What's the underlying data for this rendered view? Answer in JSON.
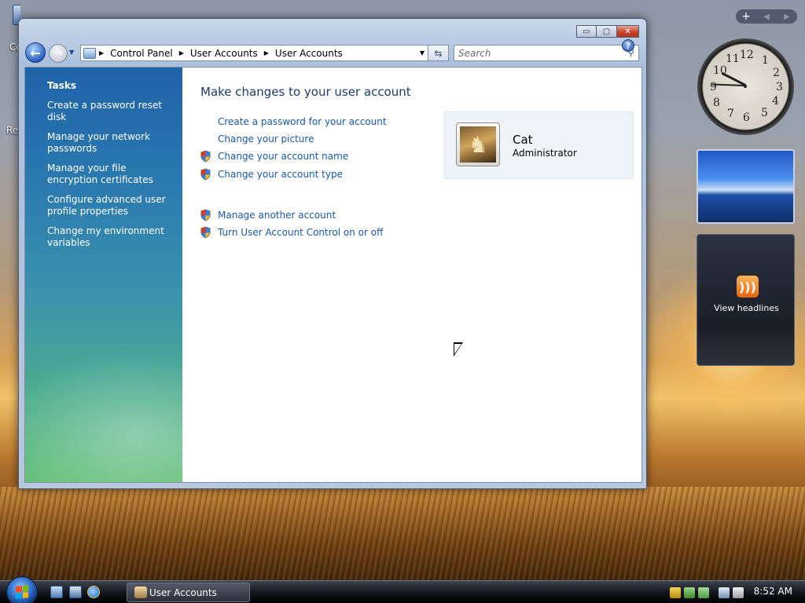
{
  "desktop": {
    "icon_label_1": "Co",
    "icon_label_2": "Re"
  },
  "window": {
    "controls": {
      "minimize": "▭",
      "maximize": "▢",
      "close": "✕"
    },
    "address_bar": {
      "crumbs": [
        "Control Panel",
        "User Accounts",
        "User Accounts"
      ]
    },
    "search": {
      "placeholder": "Search"
    },
    "sidebar": {
      "heading": "Tasks",
      "items": [
        "Create a password reset disk",
        "Manage your network passwords",
        "Manage your file encryption certificates",
        "Configure advanced user profile properties",
        "Change my environment variables"
      ]
    },
    "main": {
      "title": "Make changes to your user account",
      "links": [
        {
          "label": "Create a password for your account",
          "shield": false
        },
        {
          "label": "Change your picture",
          "shield": false
        },
        {
          "label": "Change your account name",
          "shield": true
        },
        {
          "label": "Change your account type",
          "shield": true
        },
        {
          "label": "Manage another account",
          "shield": true
        },
        {
          "label": "Turn User Account Control on or off",
          "shield": true
        }
      ],
      "account": {
        "name": "Cat",
        "type": "Administrator"
      }
    }
  },
  "gadgets": {
    "clock": {
      "numbers": [
        "12",
        "1",
        "2",
        "3",
        "4",
        "5",
        "6",
        "7",
        "8",
        "9",
        "10",
        "11"
      ],
      "time": "8:52"
    },
    "feed": {
      "label": "View headlines"
    }
  },
  "taskbar": {
    "window_button": "User Accounts",
    "clock": "8:52 AM"
  },
  "colors": {
    "link": "#1a58a8",
    "title": "#1c3a6d",
    "sidebar_top": "#1f63a8",
    "sidebar_bottom": "#5fbf75"
  }
}
